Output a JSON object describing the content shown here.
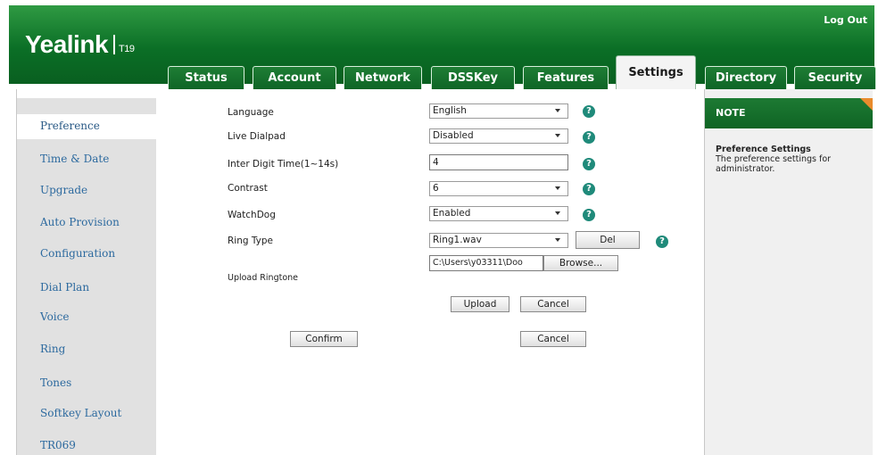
{
  "header": {
    "brand": "Yealink",
    "model": "T19",
    "logout": "Log Out",
    "tabs": [
      "Status",
      "Account",
      "Network",
      "DSSKey",
      "Features",
      "Settings",
      "Directory",
      "Security"
    ],
    "active_tab": "Settings"
  },
  "sidebar": {
    "items": [
      "Preference",
      "Time & Date",
      "Upgrade",
      "Auto Provision",
      "Configuration",
      "Dial Plan",
      "Voice",
      "Ring",
      "Tones",
      "Softkey Layout",
      "TR069"
    ],
    "active": "Preference"
  },
  "form": {
    "language": {
      "label": "Language",
      "value": "English"
    },
    "live_dialpad": {
      "label": "Live Dialpad",
      "value": "Disabled"
    },
    "inter_digit": {
      "label": "Inter Digit Time(1~14s)",
      "value": "4"
    },
    "contrast": {
      "label": "Contrast",
      "value": "6"
    },
    "watchdog": {
      "label": "WatchDog",
      "value": "Enabled"
    },
    "ring_type": {
      "label": "Ring Type",
      "value": "Ring1.wav",
      "del": "Del"
    },
    "upload_ringtone": {
      "label": "Upload Ringtone",
      "path": "C:\\Users\\y03311\\Doo",
      "browse": "Browse..."
    },
    "upload_button": "Upload",
    "upload_cancel": "Cancel",
    "confirm": "Confirm",
    "cancel": "Cancel",
    "help_glyph": "?"
  },
  "note": {
    "header": "NOTE",
    "title": "Preference Settings",
    "text": "The preference settings for administrator."
  },
  "colors": {
    "brand_green": "#0b6f26",
    "sidebar_bg": "#e1e1e1",
    "link_blue": "#2d6a9f",
    "help_teal": "#1f8a7a",
    "note_corner": "#e98b2d"
  }
}
